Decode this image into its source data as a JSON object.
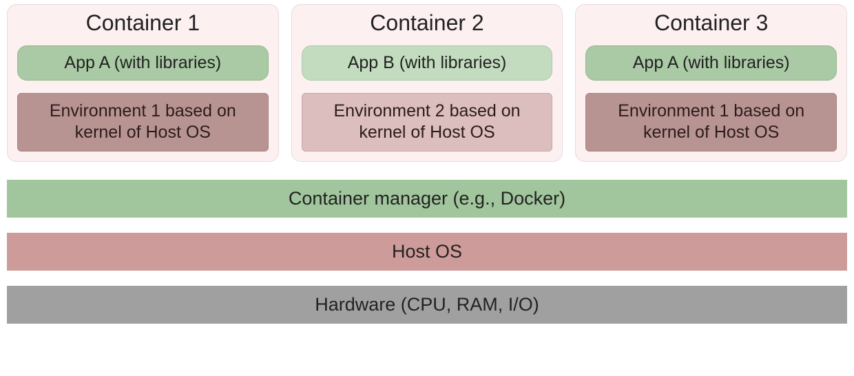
{
  "containers": [
    {
      "title": "Container 1",
      "app": "App A (with libraries)",
      "env": "Environment 1 based on kernel of Host OS",
      "appClass": "app-a",
      "envClass": "env-1"
    },
    {
      "title": "Container 2",
      "app": "App B (with libraries)",
      "env": "Environment 2 based on kernel of Host OS",
      "appClass": "app-b",
      "envClass": "env-2"
    },
    {
      "title": "Container 3",
      "app": "App A (with libraries)",
      "env": "Environment 1 based on kernel of Host OS",
      "appClass": "app-a",
      "envClass": "env-1"
    }
  ],
  "layers": {
    "manager": "Container manager (e.g., Docker)",
    "host": "Host OS",
    "hardware": "Hardware (CPU, RAM, I/O)"
  }
}
